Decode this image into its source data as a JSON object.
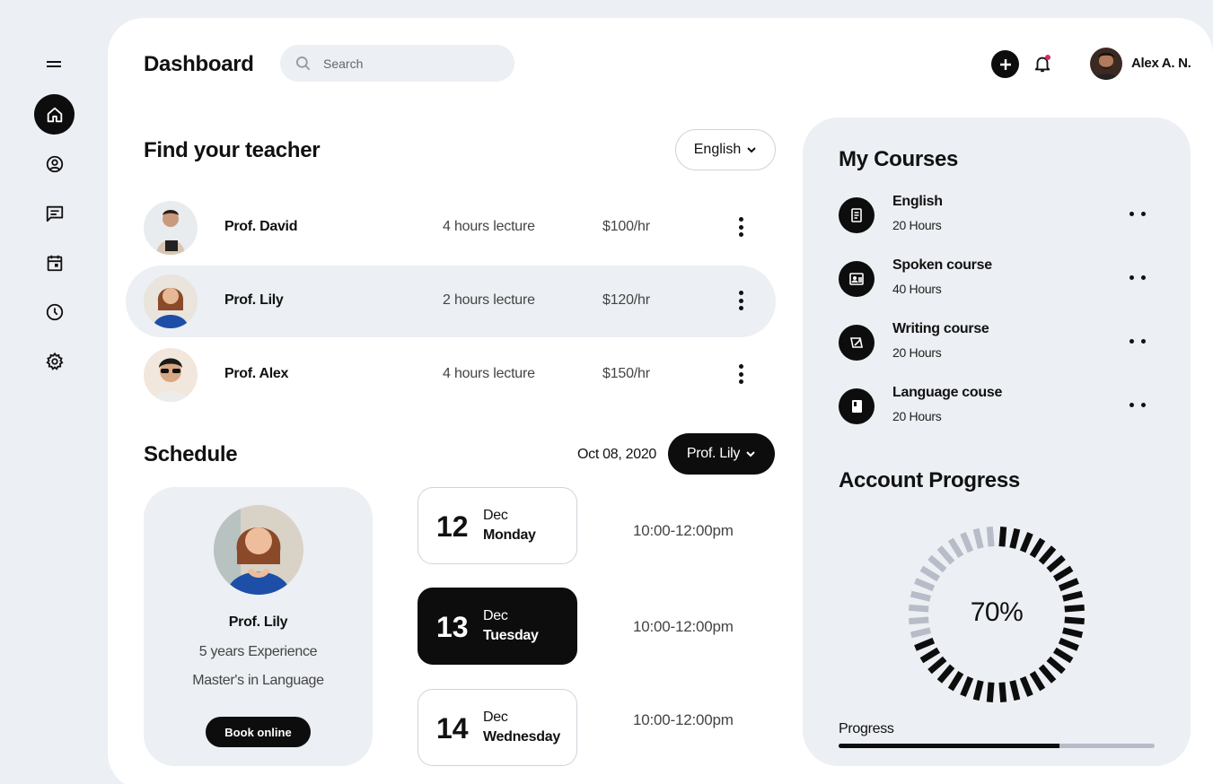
{
  "header": {
    "title": "Dashboard",
    "search_placeholder": "Search",
    "user_name": "Alex A. N."
  },
  "sidebar": {
    "items": [
      {
        "name": "home",
        "icon": "home-icon",
        "active": true
      },
      {
        "name": "profile",
        "icon": "user-circle-icon"
      },
      {
        "name": "messages",
        "icon": "message-icon"
      },
      {
        "name": "calendar",
        "icon": "calendar-icon"
      },
      {
        "name": "history",
        "icon": "clock-icon"
      },
      {
        "name": "settings",
        "icon": "gear-icon"
      }
    ]
  },
  "teachers": {
    "title": "Find your teacher",
    "language": "English",
    "rows": [
      {
        "name": "Prof. David",
        "lecture": "4 hours lecture",
        "price": "$100/hr"
      },
      {
        "name": "Prof. Lily",
        "lecture": "2 hours lecture",
        "price": "$120/hr",
        "highlight": true
      },
      {
        "name": "Prof. Alex",
        "lecture": "4 hours lecture",
        "price": "$150/hr"
      }
    ]
  },
  "schedule": {
    "title": "Schedule",
    "date": "Oct 08, 2020",
    "teacher_select": "Prof. Lily",
    "profile": {
      "name": "Prof. Lily",
      "experience": "5 years Experience",
      "degree": "Master's in Language",
      "book_label": "Book online"
    },
    "days": [
      {
        "day": "12",
        "month": "Dec",
        "weekday": "Monday",
        "time": "10:00-12:00pm"
      },
      {
        "day": "13",
        "month": "Dec",
        "weekday": "Tuesday",
        "time": "10:00-12:00pm",
        "active": true
      },
      {
        "day": "14",
        "month": "Dec",
        "weekday": "Wednesday",
        "time": "10:00-12:00pm"
      }
    ]
  },
  "courses": {
    "title": "My Courses",
    "items": [
      {
        "title": "English",
        "hours": "20 Hours",
        "icon": "script-icon"
      },
      {
        "title": "Spoken course",
        "hours": "40 Hours",
        "icon": "contact-card-icon"
      },
      {
        "title": "Writing course",
        "hours": "20 Hours",
        "icon": "pen-paper-icon"
      },
      {
        "title": "Language couse",
        "hours": "20 Hours",
        "icon": "book-icon"
      }
    ]
  },
  "progress": {
    "title": "Account Progress",
    "percent_label": "70%",
    "percent": 70,
    "bar_label": "Progress",
    "bar_value": 70,
    "colors": {
      "filled": "#0d0d0d",
      "empty": "#b7bcc8"
    }
  }
}
